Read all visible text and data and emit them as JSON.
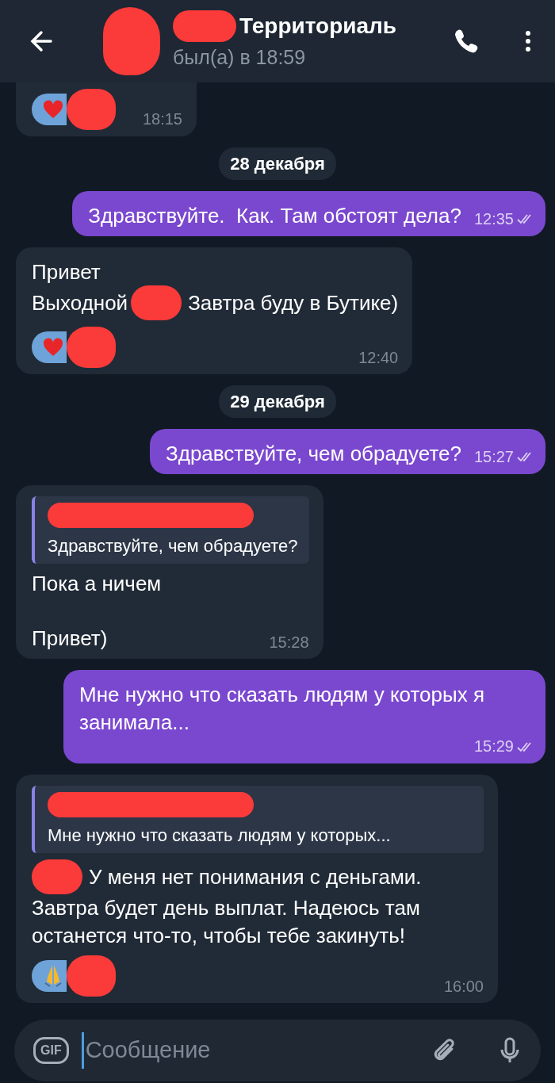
{
  "header": {
    "avatar": {
      "redacted": true
    },
    "title_parts": [
      {
        "kind": "redaction"
      },
      {
        "kind": "text",
        "text": "Территориаль"
      }
    ],
    "status": "был(а) в 18:59"
  },
  "messages": [
    {
      "kind": "message",
      "outgoing": false,
      "reaction": {
        "kind": "heart",
        "redacted": true
      },
      "time": "18:15"
    },
    {
      "kind": "date",
      "text": "28 декабря"
    },
    {
      "kind": "message",
      "outgoing": true,
      "lines": [
        [
          {
            "kind": "text",
            "text": "Здравствуйте.  Как. Там обстоят дела?"
          }
        ]
      ],
      "time": "12:35",
      "read": true
    },
    {
      "kind": "message",
      "outgoing": false,
      "lines": [
        [
          {
            "kind": "text",
            "text": "Привет"
          }
        ],
        [
          {
            "kind": "text",
            "text": "Выходной"
          },
          {
            "kind": "redaction"
          },
          {
            "kind": "text",
            "text": "Завтра буду в Бутике)"
          }
        ]
      ],
      "reaction": {
        "kind": "heart",
        "redacted": true
      },
      "time": "12:40"
    },
    {
      "kind": "date",
      "text": "29 декабря"
    },
    {
      "kind": "message",
      "outgoing": true,
      "lines": [
        [
          {
            "kind": "text",
            "text": "Здравствуйте, чем обрадуете?"
          }
        ]
      ],
      "time": "15:27",
      "read": true
    },
    {
      "kind": "message",
      "outgoing": false,
      "quote": {
        "author_redacted": true,
        "text": "Здравствуйте, чем обрадуете?"
      },
      "lines": [
        [
          {
            "kind": "text",
            "text": "Пока а ничем\n\nПривет)"
          }
        ]
      ],
      "time": "15:28"
    },
    {
      "kind": "message",
      "outgoing": true,
      "lines": [
        [
          {
            "kind": "text",
            "text": "Мне нужно что сказать людям у которых я занимала..."
          }
        ]
      ],
      "time": "15:29",
      "read": true
    },
    {
      "kind": "message",
      "outgoing": false,
      "quote": {
        "author_redacted": true,
        "text": "Мне нужно что сказать людям у которых..."
      },
      "lines": [
        [
          {
            "kind": "redaction"
          },
          {
            "kind": "text",
            "text": "У меня нет понимания с деньгами."
          }
        ],
        [
          {
            "kind": "text",
            "text": "Завтра будет день выплат. Надеюсь там останется что-то, чтобы тебе закинуть!"
          }
        ]
      ],
      "reaction": {
        "kind": "pray",
        "redacted": true
      },
      "time": "16:00"
    }
  ],
  "composer": {
    "gif": "GIF",
    "placeholder": "Сообщение"
  }
}
